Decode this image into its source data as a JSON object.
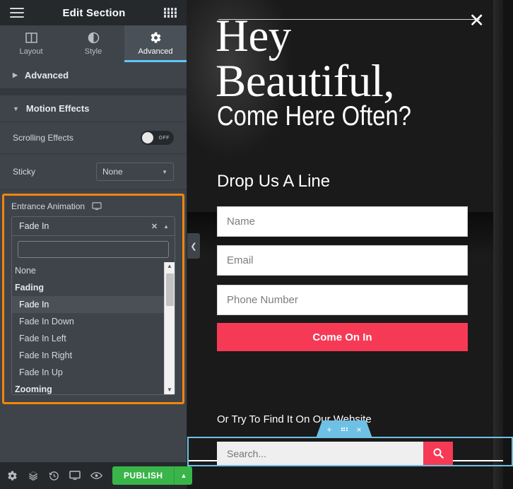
{
  "panel": {
    "header": {
      "title": "Edit Section",
      "menu_icon": "hamburger-icon",
      "apps_icon": "grid-apps-icon"
    },
    "tabs": [
      {
        "id": "layout",
        "label": "Layout",
        "icon": "columns-icon",
        "active": false
      },
      {
        "id": "style",
        "label": "Style",
        "icon": "contrast-half-circle-icon",
        "active": false
      },
      {
        "id": "advanced",
        "label": "Advanced",
        "icon": "gear-icon",
        "active": true
      }
    ],
    "sections": [
      {
        "id": "advanced",
        "label": "Advanced",
        "expanded": false
      },
      {
        "id": "motion_effects",
        "label": "Motion Effects",
        "expanded": true
      }
    ],
    "controls": {
      "scrolling_effects": {
        "label": "Scrolling Effects",
        "state": "OFF"
      },
      "sticky": {
        "label": "Sticky",
        "value": "None"
      },
      "entrance_animation": {
        "label": "Entrance Animation",
        "device_icon": "desktop-monitor-icon",
        "selected": "Fade In",
        "clear_icon": "x-clear-icon",
        "toggle_icon": "caret-up-icon",
        "search_value": "",
        "search_placeholder": "",
        "highlight_color": "#f2860c",
        "options": [
          {
            "label": "None",
            "type": "option",
            "selected": false
          },
          {
            "label": "Fading",
            "type": "group",
            "selected": false
          },
          {
            "label": "Fade In",
            "type": "option",
            "selected": true
          },
          {
            "label": "Fade In Down",
            "type": "option",
            "selected": false
          },
          {
            "label": "Fade In Left",
            "type": "option",
            "selected": false
          },
          {
            "label": "Fade In Right",
            "type": "option",
            "selected": false
          },
          {
            "label": "Fade In Up",
            "type": "option",
            "selected": false
          },
          {
            "label": "Zooming",
            "type": "group",
            "selected": false
          }
        ]
      }
    },
    "footer": {
      "icons": [
        {
          "name": "settings-gear-icon"
        },
        {
          "name": "layers-navigator-icon"
        },
        {
          "name": "history-clock-icon"
        },
        {
          "name": "responsive-monitor-icon"
        },
        {
          "name": "preview-eye-icon"
        }
      ],
      "publish_label": "PUBLISH",
      "publish_color": "#39b54a",
      "publish_dropdown_icon": "caret-up-icon"
    },
    "collapse_tab_icon": "chevron-left-icon"
  },
  "preview": {
    "popup": {
      "close_icon": "x-close-icon",
      "heading_serif": "Hey\nBeautiful,",
      "heading_condensed": "Come Here Often?",
      "form_title": "Drop Us A Line",
      "fields": [
        {
          "name": "name-field",
          "placeholder": "Name"
        },
        {
          "name": "email-field",
          "placeholder": "Email"
        },
        {
          "name": "phone-field",
          "placeholder": "Phone Number"
        }
      ],
      "submit_label": "Come On In",
      "submit_color": "#f63a56",
      "find_label": "Or Try To Find It On Our Website",
      "search_placeholder": "Search...",
      "search_icon": "magnifier-icon",
      "search_button_color": "#f63a56",
      "selection_color": "#6ec1e4",
      "section_toolbar": [
        {
          "name": "add-section-icon",
          "glyph": "+"
        },
        {
          "name": "drag-handle-dots-icon",
          "glyph": "dots"
        },
        {
          "name": "delete-section-icon",
          "glyph": "×"
        }
      ]
    }
  }
}
